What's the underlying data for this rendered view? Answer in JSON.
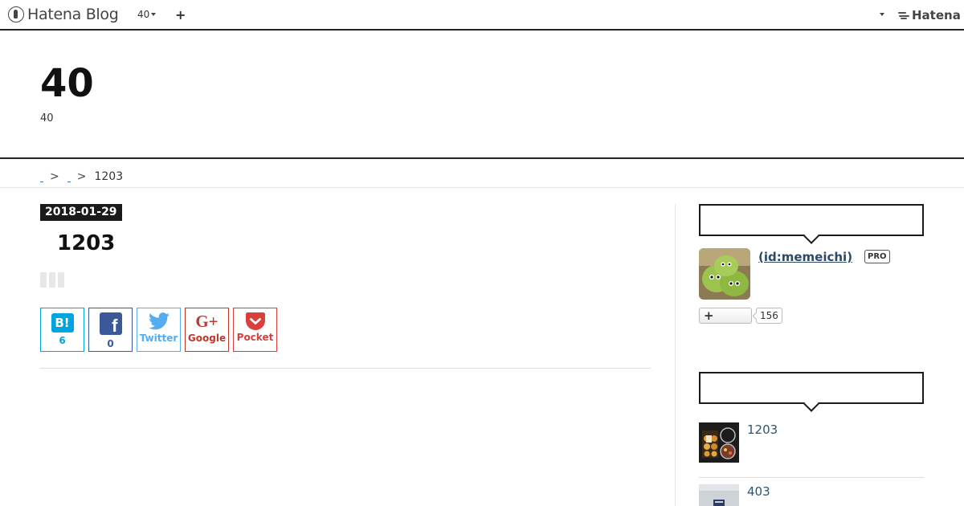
{
  "globalbar": {
    "logo_text": "Hatena Blog",
    "blog_selector": "40",
    "add_label": "+",
    "hatena_label": "Hatena"
  },
  "blog": {
    "title": "40",
    "description": "40"
  },
  "breadcrumb": {
    "separator": ">",
    "current": "1203"
  },
  "entry": {
    "date": "2018-01-29",
    "title": "1203"
  },
  "share": {
    "hatena_bookmark": {
      "icon": "B!",
      "count": "6"
    },
    "facebook": {
      "icon": "f",
      "count": "0"
    },
    "twitter": {
      "label": "Twitter"
    },
    "google": {
      "icon": "G+",
      "label": "Google"
    },
    "pocket": {
      "label": "Pocket"
    },
    "colors": {
      "hatena": "#00a4de",
      "facebook": "#3b5998",
      "twitter": "#55acee",
      "google": "#c0392b",
      "pocket": "#d9403d"
    }
  },
  "sidebar": {
    "profile": {
      "name": " (id:memeichi)",
      "badge": "PRO",
      "subscribe_icon": "+",
      "subscribers": "156"
    },
    "recent": [
      {
        "title": "1203"
      },
      {
        "title": "403"
      }
    ]
  }
}
